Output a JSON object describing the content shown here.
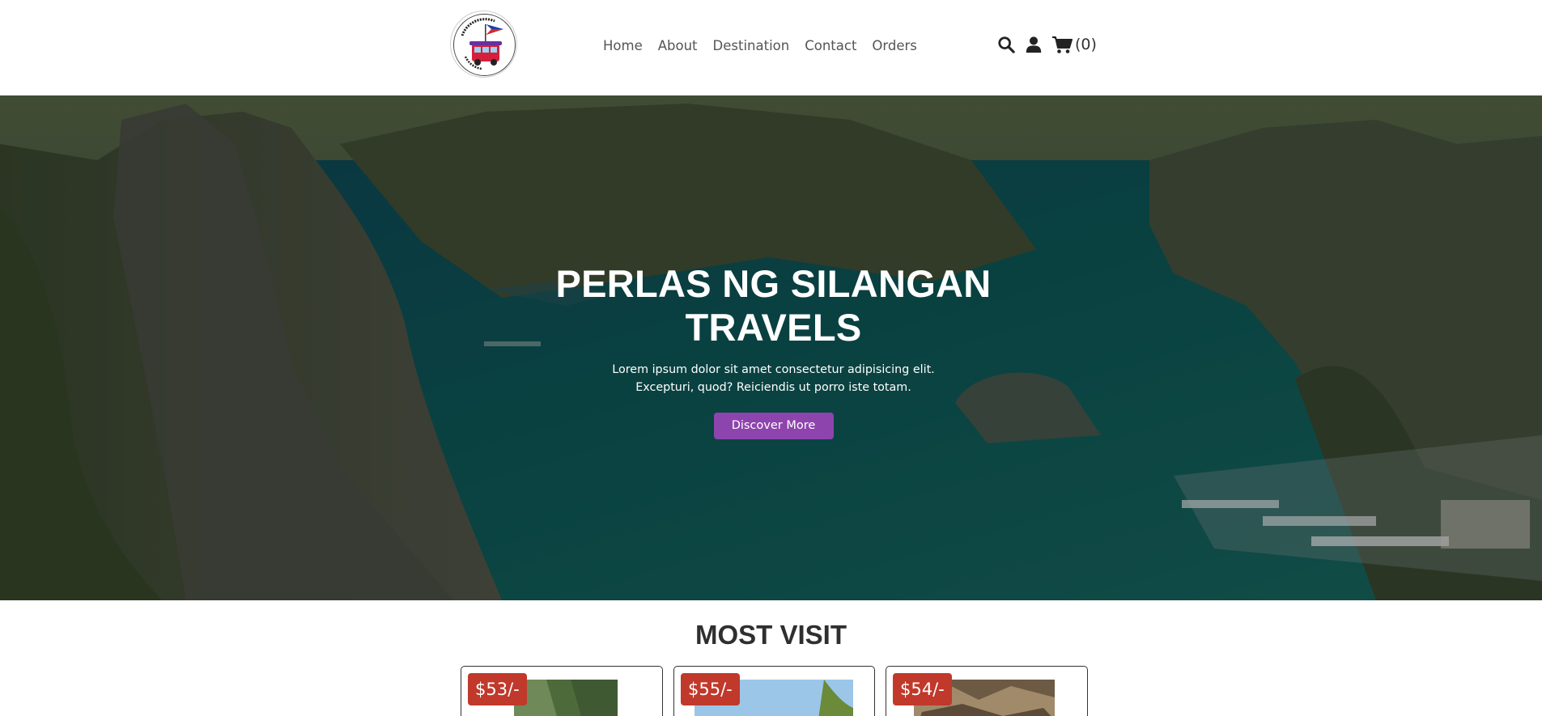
{
  "header": {
    "logo_alt": "Perlas ng Silangan Travels logo",
    "nav": [
      "Home",
      "About",
      "Destination",
      "Contact",
      "Orders"
    ],
    "icons": [
      "search-icon",
      "user-icon",
      "cart-icon"
    ],
    "cart_count": "(0)"
  },
  "hero": {
    "title": "PERLAS NG SILANGAN TRAVELS",
    "text": "Lorem ipsum dolor sit amet consectetur adipisicing elit. Excepturi, quod? Reiciendis ut porro iste totam.",
    "button": "Discover More"
  },
  "section": {
    "title": "MOST VISIT",
    "cards": [
      {
        "price": "$53/-"
      },
      {
        "price": "$55/-"
      },
      {
        "price": "$54/-"
      }
    ]
  },
  "colors": {
    "accent": "#8e44ad",
    "price_badge": "#c0392b"
  }
}
